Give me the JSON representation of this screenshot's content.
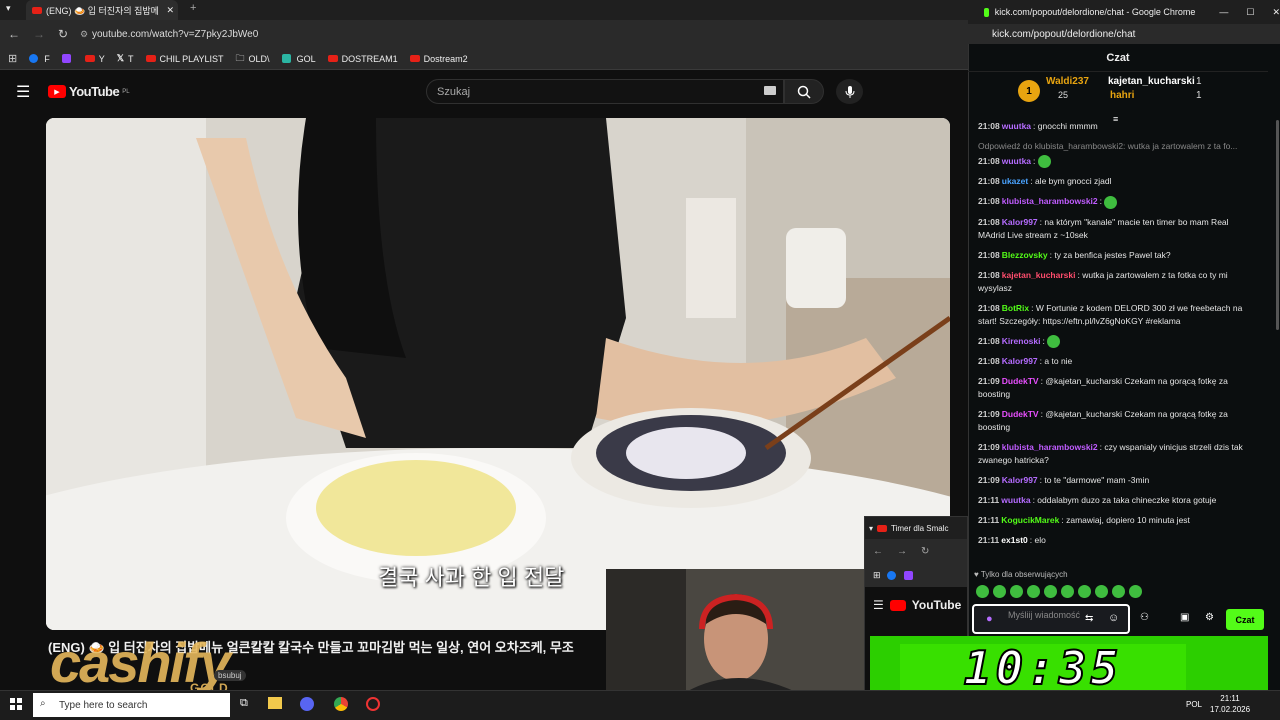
{
  "browser": {
    "tab_title": "(ENG) 🍛 입 터진자의 집밥메",
    "url": "youtube.com/watch?v=Z7pky2JbWe0",
    "bookmarks": [
      "F",
      "Y",
      "T",
      "CHIL PLAYLIST",
      "OLD\\",
      "GOL",
      "DOSTREAM1",
      "Dostream2"
    ]
  },
  "youtube": {
    "logo": "YouTube",
    "region": "PL",
    "search_placeholder": "Szukaj",
    "subtitle": "결국 사과 한 입 전달",
    "video_title": "(ENG) 🍛 입 터진자의 집밥메뉴 얼큰칼칼 칼국수 만들고 꼬마김밥 먹는 일상, 연어 오차즈케, 무조",
    "subscribe_fragment": "bsubuj"
  },
  "overlay": {
    "brand": "cashify",
    "brand_sub": "GOLD"
  },
  "chat_window": {
    "title": "kick.com/popout/delordione/chat - Google Chrome",
    "url": "kick.com/popout/delordione/chat",
    "header": "Czat",
    "leaderboard": [
      {
        "rank": "1",
        "name": "Waldi237",
        "count": "25"
      },
      {
        "name": "kajetan_kucharski",
        "count": "1"
      },
      {
        "name": "hahri",
        "count": "1"
      }
    ],
    "messages": [
      {
        "time": "21:08",
        "user": "wuutka",
        "text": "gnocchi mmmm",
        "color": "#b56cff"
      },
      {
        "reply": "Odpowiedź do klubista_harambowski2: wutka ja zartowalem z ta fo..."
      },
      {
        "time": "21:08",
        "user": "wuutka",
        "text": "",
        "color": "#b56cff"
      },
      {
        "time": "21:08",
        "user": "ukazet",
        "text": "ale bym gnocci zjadl",
        "color": "#4aa3ff"
      },
      {
        "time": "21:08",
        "user": "klubista_harambowski2",
        "text": "",
        "color": "#c05cff"
      },
      {
        "time": "21:08",
        "user": "Kalor997",
        "text": "na którym \"kanale\" macie ten timer bo mam Real MAdrid Live stream z ~10sek",
        "color": "#b56cff"
      },
      {
        "time": "21:08",
        "user": "Blezzovsky",
        "text": "ty za benfica jestes Pawel tak?",
        "color": "#53fc18"
      },
      {
        "time": "21:08",
        "user": "kajetan_kucharski",
        "text": "wutka ja zartowalem z ta fotka co ty mi wysylasz",
        "color": "#ff4d6d"
      },
      {
        "time": "21:08",
        "user": "BotRix",
        "text": "W Fortunie z kodem DELORD 300 zł we freebetach na start! Szczegóły: https://eftn.pl/lvZ6gNoKGY #reklama",
        "color": "#53fc18"
      },
      {
        "time": "21:08",
        "user": "Kirenoski",
        "text": "",
        "color": "#b56cff"
      },
      {
        "time": "21:08",
        "user": "Kalor997",
        "text": "a to nie",
        "color": "#b56cff"
      },
      {
        "time": "21:09",
        "user": "DudekTV",
        "text": "@kajetan_kucharski Czekam na gorącą fotkę za boosting",
        "color": "#e94fff"
      },
      {
        "time": "21:09",
        "user": "DudekTV",
        "text": "@kajetan_kucharski Czekam na gorącą fotkę za boosting",
        "color": "#e94fff"
      },
      {
        "time": "21:09",
        "user": "klubista_harambowski2",
        "text": "czy wspanialy vinicjus strzeli dzis tak zwanego hatricka?",
        "color": "#c05cff"
      },
      {
        "time": "21:09",
        "user": "Kalor997",
        "text": "to te \"darmowe\" mam -3min",
        "color": "#b56cff"
      },
      {
        "time": "21:11",
        "user": "wuutka",
        "text": "oddalabym duzo za taka chineczke ktora gotuje",
        "color": "#b56cff"
      },
      {
        "time": "21:11",
        "user": "KogucikMarek",
        "text": "zamawiaj, dopiero 10 minuta jest",
        "color": "#53fc18"
      },
      {
        "time": "21:11",
        "user": "ex1st0",
        "text": "elo",
        "color": "#ffffff"
      }
    ],
    "followers_only": "Tylko dla obserwujących",
    "input_placeholder": "Myśliij wiadomość",
    "send_label": "Czat"
  },
  "small_window": {
    "tab_title": "Timer dla Smalc",
    "logo": "YouTube"
  },
  "timer": "10:35",
  "taskbar": {
    "search_placeholder": "Type here to search",
    "lang": "POL",
    "time": "21:11",
    "date": "17.02.2026"
  }
}
